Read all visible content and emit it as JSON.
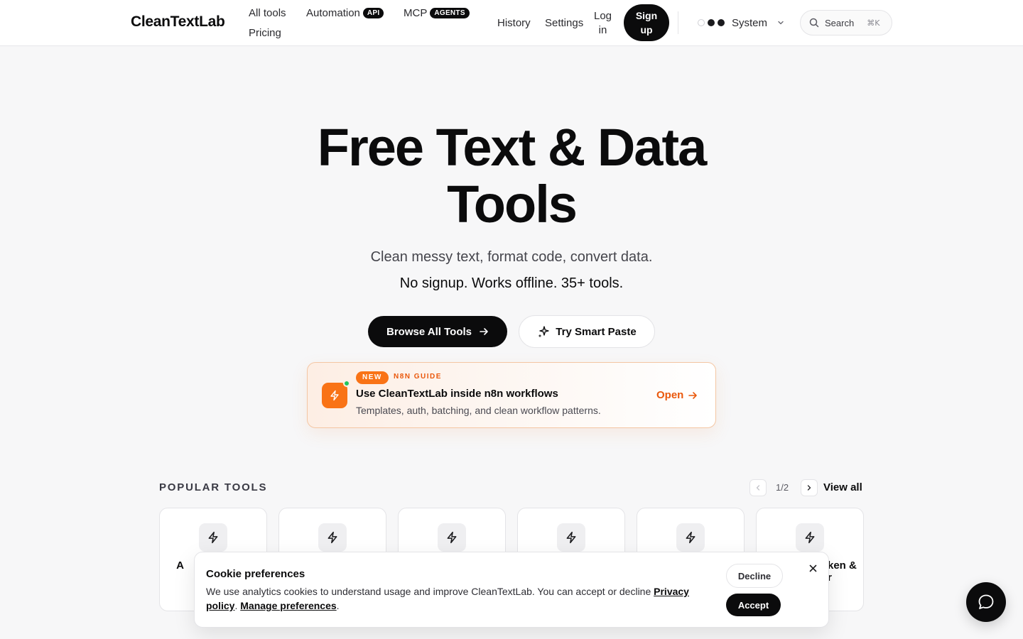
{
  "header": {
    "brand": "CleanTextLab",
    "nav": {
      "all_tools": "All tools",
      "automation": "Automation",
      "automation_badge": "API",
      "mcp": "MCP",
      "mcp_badge": "AGENTS",
      "pricing": "Pricing",
      "history": "History",
      "settings": "Settings",
      "login_line1": "Log",
      "login_line2": "in",
      "signup_line1": "Sign",
      "signup_line2": "up"
    },
    "theme": {
      "label": "System",
      "icon": "chevron-down-icon"
    },
    "search": {
      "label": "Search",
      "shortcut": "⌘K",
      "icon": "search-icon"
    }
  },
  "hero": {
    "title_line1": "Free Text & Data",
    "title_line2": "Tools",
    "subtitle": "Clean messy text, format code, convert data.",
    "tagline": "No signup. Works offline. 35+ tools.",
    "primary_button": "Browse All Tools",
    "secondary_button": "Try Smart Paste"
  },
  "promo": {
    "badge": "NEW",
    "tag": "N8N GUIDE",
    "title": "Use CleanTextLab inside n8n workflows",
    "description": "Templates, auth, batching, and clean workflow patterns.",
    "action": "Open",
    "accent_color": "#f97316"
  },
  "popular": {
    "label": "POPULAR TOOLS",
    "page": "1/2",
    "view_all": "View all",
    "tools": [
      {
        "name": "A                    G",
        "icon": "bolt-icon"
      },
      {
        "name": "",
        "icon": "bolt-icon"
      },
      {
        "name": "",
        "icon": "bolt-icon"
      },
      {
        "name": "",
        "icon": "bolt-icon"
      },
      {
        "name": "",
        "icon": "bolt-icon"
      },
      {
        "name": "ken & r",
        "icon": "bolt-icon"
      }
    ]
  },
  "cookie": {
    "title": "Cookie preferences",
    "text": "We use analytics cookies to understand usage and improve CleanTextLab. You can accept or decline ",
    "privacy_link": "Privacy policy",
    "separator": ". ",
    "manage_link": "Manage preferences",
    "end": ".",
    "decline": "Decline",
    "accept": "Accept"
  }
}
